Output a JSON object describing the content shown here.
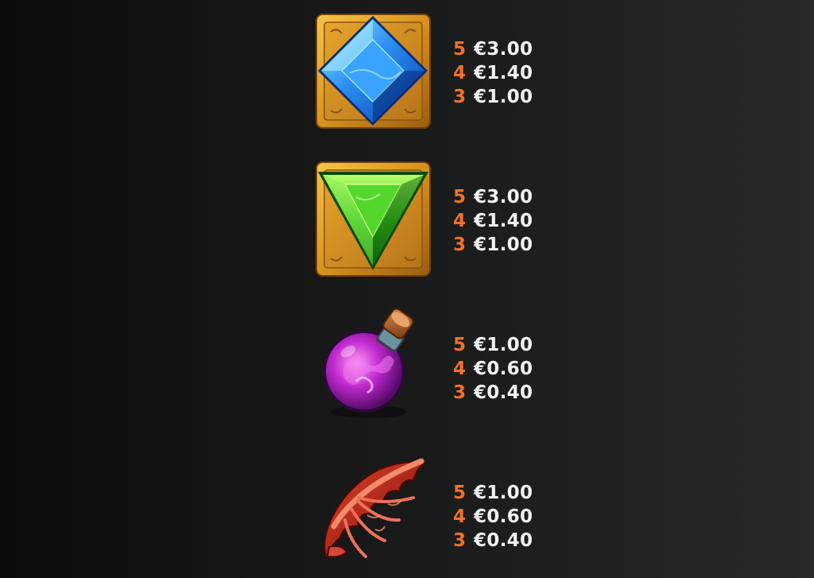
{
  "colors": {
    "count_color": "#f2702b",
    "amount_color": "#f3f3f3",
    "background_left": "#0c0c0c",
    "background_right": "#26282b"
  },
  "paytable": [
    {
      "symbol": "blue-diamond-gem-icon",
      "pays": [
        {
          "count": "5",
          "amount": "€3.00"
        },
        {
          "count": "4",
          "amount": "€1.40"
        },
        {
          "count": "3",
          "amount": "€1.00"
        }
      ]
    },
    {
      "symbol": "green-triangle-gem-icon",
      "pays": [
        {
          "count": "5",
          "amount": "€3.00"
        },
        {
          "count": "4",
          "amount": "€1.40"
        },
        {
          "count": "3",
          "amount": "€1.00"
        }
      ]
    },
    {
      "symbol": "pink-potion-bottle-icon",
      "pays": [
        {
          "count": "5",
          "amount": "€1.00"
        },
        {
          "count": "4",
          "amount": "€0.60"
        },
        {
          "count": "3",
          "amount": "€0.40"
        }
      ]
    },
    {
      "symbol": "red-dragon-wing-icon",
      "pays": [
        {
          "count": "5",
          "amount": "€1.00"
        },
        {
          "count": "4",
          "amount": "€0.60"
        },
        {
          "count": "3",
          "amount": "€0.40"
        }
      ]
    }
  ]
}
